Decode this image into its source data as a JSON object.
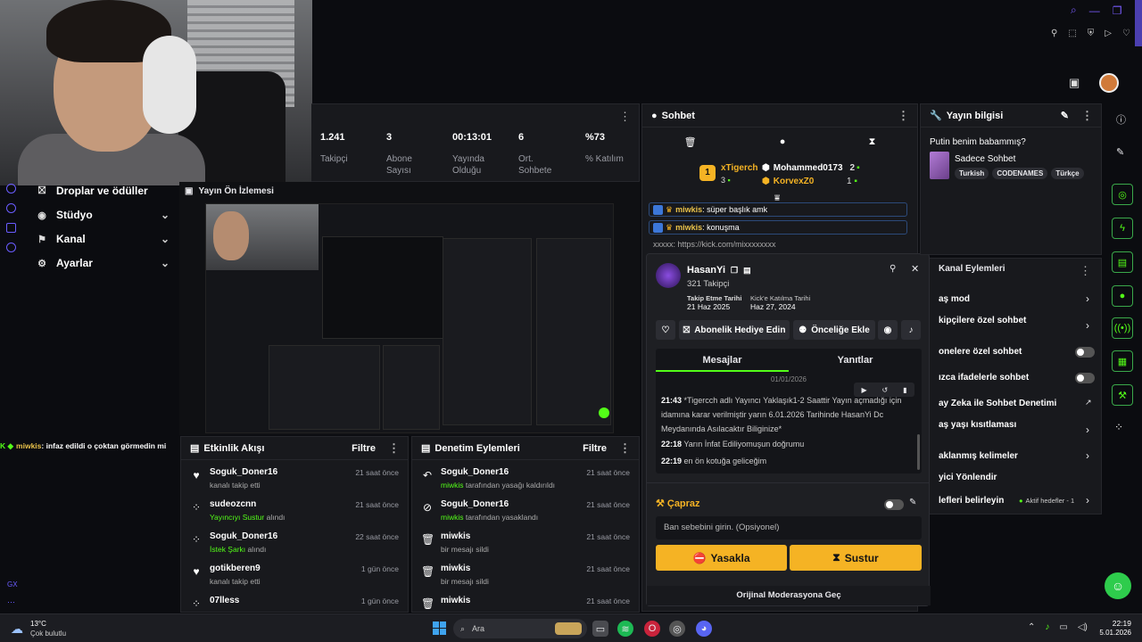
{
  "colors": {
    "accent": "#53fc18",
    "warn": "#f5b324",
    "bg": "#0b0c10",
    "panel": "#18191d"
  },
  "window_controls": {
    "icons": [
      "search-icon",
      "minimize-icon",
      "restore-icon",
      "close-icon"
    ]
  },
  "top_bar_icons": [
    "pin-icon",
    "popout-icon",
    "shield-icon",
    "play-icon",
    "heart-icon"
  ],
  "nav": {
    "items": [
      {
        "label": "Droplar ve ödüller",
        "icon": "gift-icon"
      },
      {
        "label": "Stüdyo",
        "icon": "studio-icon"
      },
      {
        "label": "Kanal",
        "icon": "channel-icon"
      },
      {
        "label": "Ayarlar",
        "icon": "gear-icon"
      }
    ],
    "footer": "GX"
  },
  "stats": [
    {
      "value": "1.241",
      "label": "Takipçi"
    },
    {
      "value": "3",
      "label": "Abone Sayısı"
    },
    {
      "value": "00:13:01",
      "label": "Yayında Olduğu"
    },
    {
      "value": "6",
      "label": "Ort. Sohbete"
    },
    {
      "value": "%73",
      "label": "% Katılım"
    }
  ],
  "preview": {
    "title": "Yayın Ön İzlemesi"
  },
  "ticker": {
    "user": "miwkis",
    "text": ": infaz edildi o çoktan görmedin mi"
  },
  "chat": {
    "title": "Sohbet",
    "leaderboard": [
      {
        "name": "xTigerch",
        "count": "3",
        "rank": "1"
      },
      {
        "name": "Mohammed0173",
        "count": "2"
      },
      {
        "name": "KorvexZ0",
        "count": "1"
      }
    ],
    "messages": [
      {
        "user": "miwkis",
        "text": ": süper başlık amk"
      },
      {
        "user": "miwkis",
        "text": ": konuşma"
      }
    ],
    "partial_line": "xxxxx: https://kick.com/mixxxxxxxx"
  },
  "stream_info": {
    "title": "Yayın bilgisi",
    "stream_title": "Putin benim babammış?",
    "category_mode": "Sadece Sohbet",
    "tags": [
      "Turkish",
      "CODENAMES",
      "Türkçe"
    ]
  },
  "channel_actions": {
    "title": "Kanal Eylemleri",
    "items": [
      {
        "label": "aş mod",
        "control": "chevron"
      },
      {
        "label": "kipçilere özel sohbet",
        "control": "chevron"
      },
      {
        "label": "onelere özel sohbet",
        "control": "toggle"
      },
      {
        "label": "ızca ifadelerle sohbet",
        "control": "toggle"
      },
      {
        "label": "ay Zeka ile Sohbet Denetimi",
        "control": "external"
      },
      {
        "label": "aş yaşı kısıtlaması",
        "control": "chevron"
      },
      {
        "label": "aklanmış kelimeler",
        "control": "chevron"
      },
      {
        "label": "yici Yönlendir",
        "control": "none"
      },
      {
        "label": "lefleri belirleyin",
        "control": "chevron",
        "extra": "Aktif hedefler - 1"
      }
    ]
  },
  "activity": {
    "title": "Etkinlik Akışı",
    "filter": "Filtre",
    "items": [
      {
        "icon": "heart-icon",
        "name": "Soguk_Doner16",
        "sub": "kanalı takip etti",
        "time": "21 saat önce",
        "hl": ""
      },
      {
        "icon": "kick-icon",
        "name": "sudeozcnn",
        "sub": " alındı",
        "hl": "Yayıncıyı Sustur",
        "time": "21 saat önce"
      },
      {
        "icon": "kick-icon",
        "name": "Soguk_Doner16",
        "sub": " alındı",
        "hl": "İstek Şarkı",
        "time": "22 saat önce"
      },
      {
        "icon": "heart-icon",
        "name": "gotikberen9",
        "sub": "kanalı takip etti",
        "time": "1 gün önce",
        "hl": ""
      },
      {
        "icon": "kick-icon",
        "name": "07lless",
        "sub": "",
        "time": "1 gün önce",
        "hl": ""
      }
    ]
  },
  "moderation": {
    "title": "Denetim Eylemleri",
    "filter": "Filtre",
    "items": [
      {
        "icon": "undo-icon",
        "name": "Soguk_Doner16",
        "hl": "miwkis",
        "sub": " tarafından yasağı kaldırıldı",
        "time": "21 saat önce"
      },
      {
        "icon": "ban-icon",
        "name": "Soguk_Doner16",
        "hl": "miwkis",
        "sub": " tarafından yasaklandı",
        "time": "21 saat önce"
      },
      {
        "icon": "trash-icon",
        "name": "miwkis",
        "hl": "",
        "sub": "bir mesajı sildi",
        "time": "21 saat önce"
      },
      {
        "icon": "trash-icon",
        "name": "miwkis",
        "hl": "",
        "sub": "bir mesajı sildi",
        "time": "21 saat önce"
      },
      {
        "icon": "trash-icon",
        "name": "miwkis",
        "hl": "",
        "sub": "",
        "time": "21 saat önce"
      }
    ]
  },
  "usercard": {
    "name": "HasanYi",
    "followers": "321 Takipçi",
    "follow_label": "Takip Etme Tarihi",
    "follow_date": "21 Haz 2025",
    "join_label": "Kick'e Katılma Tarihi",
    "join_date": "Haz 27, 2024",
    "gift_btn": "Abonelik Hediye Edin",
    "priority_btn": "Önceliğe Ekle",
    "tab_messages": "Mesajlar",
    "tab_replies": "Yanıtlar",
    "date_sep": "01/01/2026",
    "messages": [
      {
        "time": "21:43",
        "text": "*Tigercch adlı Yayıncı Yaklaşık1-2 Saattir Yayın açmadığı için idamına karar verilmiştir yarın 6.01.2026 Tarihinde HasanYi Dc Meydanında Asılacaktır Biliginize*"
      },
      {
        "time": "22:18",
        "text": "Yarın İnfat Ediliyomuşun doğrumu"
      },
      {
        "time": "22:19",
        "text": "en ön kotuğa geliceğim"
      }
    ],
    "cross_label": "Çapraz",
    "ban_placeholder": "Ban sebebini girin. (Opsiyonel)",
    "ban_btn": "Yasakla",
    "mute_btn": "Sustur",
    "orig_mod": "Orijinal Moderasyona Geç"
  },
  "taskbar": {
    "temp": "13°C",
    "weather": "Çok bulutlu",
    "search": "Ara",
    "time": "22:19",
    "date": "5.01.2026"
  }
}
